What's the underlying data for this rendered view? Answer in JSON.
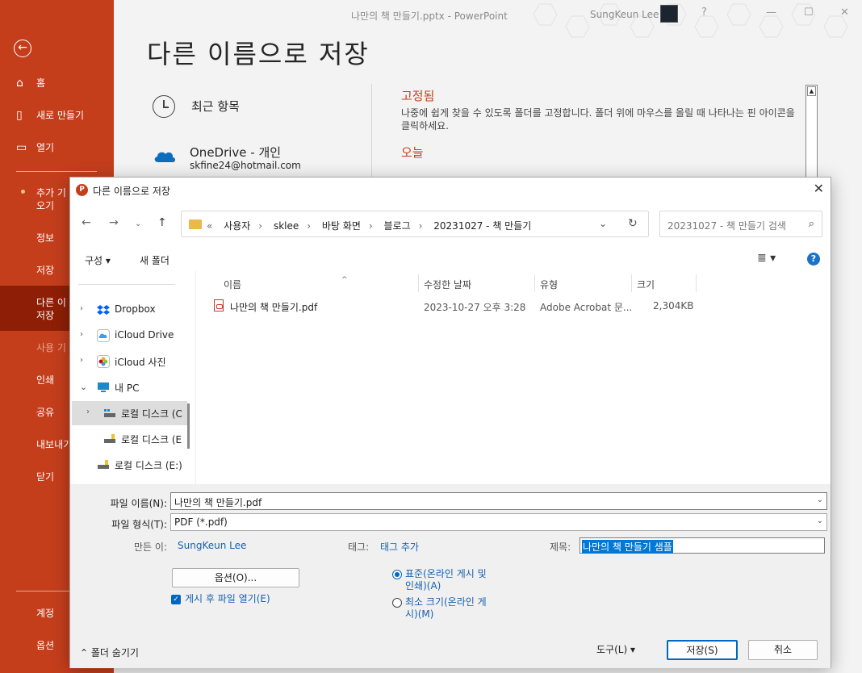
{
  "backstage": {
    "back_label": "←",
    "nav": [
      {
        "label": "홈",
        "icon": "home-icon"
      },
      {
        "label": "새로 만들기",
        "icon": "new-document-icon"
      },
      {
        "label": "열기",
        "icon": "open-folder-icon"
      },
      {
        "label": "추가 기능 가져오기"
      },
      {
        "label": "정보"
      },
      {
        "label": "저장"
      },
      {
        "label": "다른 이름으로 저장"
      },
      {
        "label": "사용 기록"
      },
      {
        "label": "인쇄"
      },
      {
        "label": "공유"
      },
      {
        "label": "내보내기"
      },
      {
        "label": "닫기"
      },
      {
        "label": "계정"
      },
      {
        "label": "옵션"
      }
    ],
    "addin_line1": "추가 기",
    "addin_line2": "오기",
    "saveas_line1": "다른 이",
    "saveas_line2": "저장",
    "history_short": "사용 기",
    "export_short": "내보내기"
  },
  "titlebar": {
    "doc": "나만의 책 만들기.pptx  -  PowerPoint",
    "user": "SungKeun Lee"
  },
  "page": {
    "title": "다른 이름으로 저장",
    "recent": "최근 항목",
    "onedrive": "OneDrive - 개인",
    "onedrive_email": "skfine24@hotmail.com",
    "pinned_heading": "고정됨",
    "pinned_desc": "나중에 쉽게 찾을 수 있도록 폴더를 고정합니다. 폴더 위에 마우스를 올릴 때 나타나는 핀 아이콘을 클릭하세요.",
    "today": "오늘"
  },
  "dialog": {
    "title": "다른 이름으로 저장",
    "address": {
      "prefix": "«",
      "crumbs": [
        "사용자",
        "sklee",
        "바탕 화면",
        "블로그",
        "20231027 - 책 만들기"
      ]
    },
    "search_placeholder": "20231027 - 책 만들기 검색",
    "toolbar": {
      "organize": "구성 ▾",
      "new_folder": "새 폴더"
    },
    "tree": [
      {
        "label": "Dropbox",
        "icon": "dropbox-icon"
      },
      {
        "label": "iCloud Drive",
        "icon": "icloud-icon"
      },
      {
        "label": "iCloud 사진",
        "icon": "icloud-photos-icon"
      },
      {
        "label": "내 PC",
        "icon": "pc-icon"
      },
      {
        "label": "로컬 디스크 (C",
        "icon": "drive-icon"
      },
      {
        "label": "로컬 디스크 (E",
        "icon": "drive-icon"
      },
      {
        "label": "로컬 디스크 (E:)",
        "icon": "drive-icon"
      }
    ],
    "columns": {
      "name": "이름",
      "modified": "수정한 날짜",
      "type": "유형",
      "size": "크기"
    },
    "files": [
      {
        "name": "나만의 책 만들기.pdf",
        "modified": "2023-10-27 오후 3:28",
        "type": "Adobe Acrobat 문...",
        "size": "2,304KB"
      }
    ],
    "form": {
      "filename_label": "파일 이름(N):",
      "filename_value": "나만의 책 만들기.pdf",
      "filetype_label": "파일 형식(T):",
      "filetype_value": "PDF (*.pdf)",
      "author_label": "만든 이:",
      "author_value": "SungKeun Lee",
      "tags_label": "태그:",
      "tags_value": "태그 추가",
      "title_label": "제목:",
      "title_value": "나만의 책 만들기 샘플",
      "options_button": "옵션(O)...",
      "open_after": "게시 후 파일 열기(E)",
      "radio_standard_1": "표준(온라인 게시 및",
      "radio_standard_2": "인쇄)(A)",
      "radio_min_1": "최소 크기(온라인 게",
      "radio_min_2": "시)(M)"
    },
    "bottom": {
      "hide_folders": "폴더 숨기기",
      "tools": "도구(L)",
      "save": "저장(S)",
      "cancel": "취소"
    }
  }
}
